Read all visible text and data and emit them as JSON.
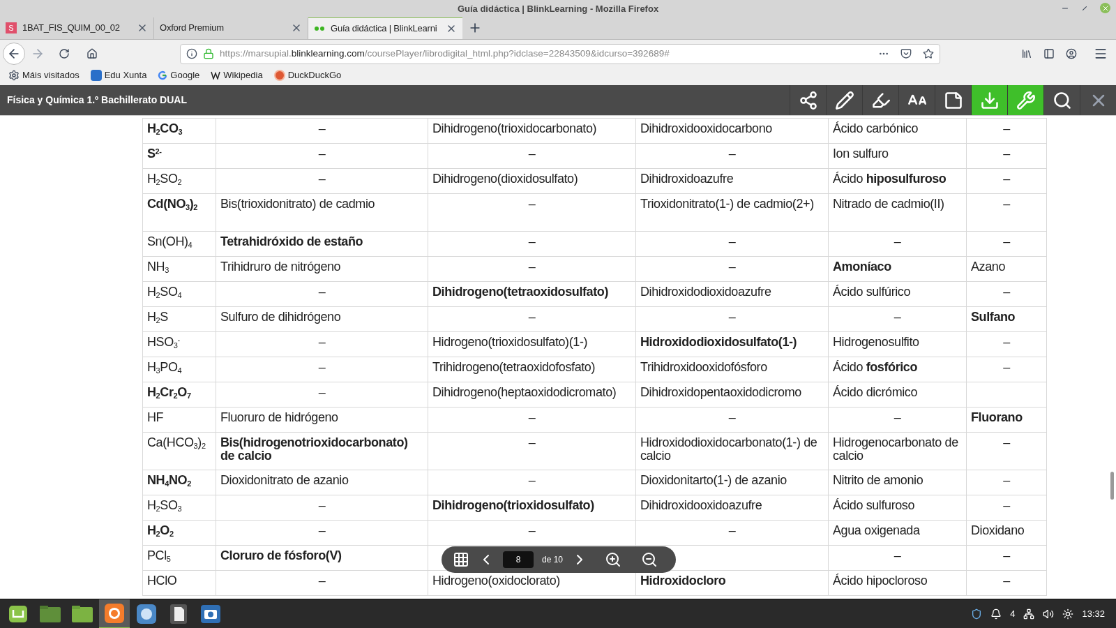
{
  "window": {
    "title": "Guía didáctica | BlinkLearning - Mozilla Firefox"
  },
  "tabs": [
    {
      "label": "1BAT_FIS_QUIM_00_02",
      "favicon_text": "S",
      "selected": false
    },
    {
      "label": "Oxford Premium",
      "selected": false
    },
    {
      "label": "Guía didáctica | BlinkLearni",
      "selected": true
    }
  ],
  "address": {
    "prefix": "https://marsupial.",
    "domain": "blinklearning.com",
    "path": "/coursePlayer/librodigital_html.php?idclase=22843509&idcurso=392689#"
  },
  "bookmarks": [
    {
      "label": "Máis visitados",
      "kind": "gear"
    },
    {
      "label": "Edu Xunta",
      "kind": "xunta"
    },
    {
      "label": "Google",
      "kind": "google"
    },
    {
      "label": "Wikipedia",
      "kind": "wikipedia"
    },
    {
      "label": "DuckDuckGo",
      "kind": "duck"
    }
  ],
  "app_bar": {
    "title": "Física y Química 1.º Bachillerato DUAL",
    "tools": [
      {
        "kind": "share",
        "active": false
      },
      {
        "kind": "pencil",
        "active": false
      },
      {
        "kind": "marker",
        "active": false
      },
      {
        "kind": "font-size",
        "active": false
      },
      {
        "kind": "note",
        "active": false
      },
      {
        "kind": "download",
        "active": true
      },
      {
        "kind": "wrench",
        "active": true
      },
      {
        "kind": "search",
        "active": false
      },
      {
        "kind": "close",
        "active": false
      }
    ]
  },
  "table": {
    "rows": [
      {
        "formula": "H$_{2}$CO$_{3}$",
        "bold": true,
        "cells": [
          {
            "kind": "dash",
            "t": "–"
          },
          {
            "kind": "text",
            "t": "Dihidrogeno(trioxidocarbonato)",
            "bold": false
          },
          {
            "kind": "text",
            "t": "Dihidroxidooxidocarbono",
            "bold": false
          },
          {
            "kind": "text",
            "t": "Ácido carbónico",
            "bold": false
          },
          {
            "kind": "dash",
            "t": "–"
          }
        ]
      },
      {
        "formula": "S$^{2-}$",
        "bold": true,
        "cells": [
          {
            "kind": "dash",
            "t": "–"
          },
          {
            "kind": "dash",
            "t": "–"
          },
          {
            "kind": "dash",
            "t": "–"
          },
          {
            "kind": "text",
            "t": "Ion sulfuro",
            "bold": false
          },
          {
            "kind": "dash",
            "t": "–"
          }
        ]
      },
      {
        "formula": "H$_{2}$SO$_{2}$",
        "bold": false,
        "cells": [
          {
            "kind": "dash",
            "t": "–"
          },
          {
            "kind": "text",
            "t": "Dihidrogeno(dioxidosulfato)",
            "bold": false
          },
          {
            "kind": "text",
            "t": "Dihidroxidoazufre",
            "bold": false
          },
          {
            "kind": "text",
            "t": "Ácido **hiposulfuroso**",
            "bold": false
          },
          {
            "kind": "dash",
            "t": "–"
          }
        ]
      },
      {
        "formula": "Cd(NO$_{3}$)$_{2}$",
        "bold": true,
        "tall": true,
        "cells": [
          {
            "kind": "text",
            "t": "Bis(trioxidonitrato) de cadmio",
            "bold": false
          },
          {
            "kind": "dash",
            "t": "–"
          },
          {
            "kind": "text",
            "t": "Trioxidonitrato(1-) de cadmio(2+)",
            "bold": false
          },
          {
            "kind": "text",
            "t": "Nitrado de cadmio(II)",
            "bold": false
          },
          {
            "kind": "dash",
            "t": "–"
          }
        ]
      },
      {
        "formula": "Sn(OH)$_{4}$",
        "bold": false,
        "cells": [
          {
            "kind": "text",
            "t": "Tetrahidróxido de estaño",
            "bold": true
          },
          {
            "kind": "dash",
            "t": "–"
          },
          {
            "kind": "dash",
            "t": "–"
          },
          {
            "kind": "dash",
            "t": "–"
          },
          {
            "kind": "dash",
            "t": "–"
          }
        ]
      },
      {
        "formula": "NH$_{3}$",
        "bold": false,
        "cells": [
          {
            "kind": "text",
            "t": "Trihidruro de nitrógeno",
            "bold": false
          },
          {
            "kind": "dash",
            "t": "–"
          },
          {
            "kind": "dash",
            "t": "–"
          },
          {
            "kind": "text",
            "t": "Amoníaco",
            "bold": true
          },
          {
            "kind": "text",
            "t": "Azano",
            "bold": false
          }
        ]
      },
      {
        "formula": "H$_{2}$SO$_{4}$",
        "bold": false,
        "cells": [
          {
            "kind": "dash",
            "t": "–"
          },
          {
            "kind": "text",
            "t": "Dihidrogeno(tetraoxidosulfato)",
            "bold": true
          },
          {
            "kind": "text",
            "t": "Dihidroxidodioxidoazufre",
            "bold": false
          },
          {
            "kind": "text",
            "t": "Ácido sulfúrico",
            "bold": false
          },
          {
            "kind": "dash",
            "t": "–"
          }
        ]
      },
      {
        "formula": "H$_{2}$S",
        "bold": false,
        "cells": [
          {
            "kind": "text",
            "t": "Sulfuro de dihidrógeno",
            "bold": false
          },
          {
            "kind": "dash",
            "t": "–"
          },
          {
            "kind": "dash",
            "t": "–"
          },
          {
            "kind": "dash",
            "t": "–"
          },
          {
            "kind": "text",
            "t": "Sulfano",
            "bold": true
          }
        ]
      },
      {
        "formula": "HSO$_{3}$$^{-}$",
        "bold": false,
        "cells": [
          {
            "kind": "dash",
            "t": "–"
          },
          {
            "kind": "text",
            "t": "Hidrogeno(trioxidosulfato)(1-)",
            "bold": false
          },
          {
            "kind": "text",
            "t": "Hidroxidodioxidosulfato(1-)",
            "bold": true
          },
          {
            "kind": "text",
            "t": "Hidrogenosulfito",
            "bold": false
          },
          {
            "kind": "dash",
            "t": "–"
          }
        ]
      },
      {
        "formula": "H$_{3}$PO$_{4}$",
        "bold": false,
        "cells": [
          {
            "kind": "dash",
            "t": "–"
          },
          {
            "kind": "text",
            "t": "Trihidrogeno(tetraoxidofosfato)",
            "bold": false
          },
          {
            "kind": "text",
            "t": "Trihidroxidooxidofósforo",
            "bold": false
          },
          {
            "kind": "text",
            "t": "Ácido **fosfórico**",
            "bold": false
          },
          {
            "kind": "dash",
            "t": "–"
          }
        ]
      },
      {
        "formula": "H$_{2}$Cr$_{2}$O$_{7}$",
        "bold": true,
        "cells": [
          {
            "kind": "dash",
            "t": "–"
          },
          {
            "kind": "text",
            "t": "Dihidrogeno(heptaoxidodicromato)",
            "bold": false
          },
          {
            "kind": "text",
            "t": "Dihidroxidopentaoxidodicromo",
            "bold": false
          },
          {
            "kind": "text",
            "t": "Ácido dicrómico",
            "bold": false
          },
          {
            "kind": "blank"
          }
        ]
      },
      {
        "formula": "HF",
        "bold": false,
        "cells": [
          {
            "kind": "text",
            "t": "Fluoruro de hidrógeno",
            "bold": false
          },
          {
            "kind": "dash",
            "t": "–"
          },
          {
            "kind": "dash",
            "t": "–"
          },
          {
            "kind": "dash",
            "t": "–"
          },
          {
            "kind": "text",
            "t": "Fluorano",
            "bold": true
          }
        ]
      },
      {
        "formula": "Ca(HCO$_{3}$)$_{2}$",
        "bold": false,
        "tall": true,
        "cells": [
          {
            "kind": "text",
            "t": "Bis(hidrogenotrioxidocarbonato) de calcio",
            "bold": true
          },
          {
            "kind": "dash",
            "t": "–"
          },
          {
            "kind": "text",
            "t": "Hidroxidodioxidocarbonato(1-) de calcio",
            "bold": false
          },
          {
            "kind": "text",
            "t": "Hidrogenocarbonato de calcio",
            "bold": false
          },
          {
            "kind": "dash",
            "t": "–"
          }
        ]
      },
      {
        "formula": "NH$_{4}$NO$_{2}$",
        "bold": true,
        "cells": [
          {
            "kind": "text",
            "t": "Dioxidonitrato de azanio",
            "bold": false
          },
          {
            "kind": "dash",
            "t": "–"
          },
          {
            "kind": "text",
            "t": "Dioxidonitarto(1-) de azanio",
            "bold": false
          },
          {
            "kind": "text",
            "t": "Nitrito de amonio",
            "bold": false
          },
          {
            "kind": "dash",
            "t": "–"
          }
        ]
      },
      {
        "formula": "H$_{2}$SO$_{3}$",
        "bold": false,
        "cells": [
          {
            "kind": "dash",
            "t": "–"
          },
          {
            "kind": "text",
            "t": "Dihidrogeno(trioxidosulfato)",
            "bold": true
          },
          {
            "kind": "text",
            "t": "Dihidroxidooxidoazufre",
            "bold": false
          },
          {
            "kind": "text",
            "t": "Ácido sulfuroso",
            "bold": false
          },
          {
            "kind": "dash",
            "t": "–"
          }
        ]
      },
      {
        "formula": "H$_{2}$O$_{2}$",
        "bold": true,
        "cells": [
          {
            "kind": "dash",
            "t": "–"
          },
          {
            "kind": "dash",
            "t": "–"
          },
          {
            "kind": "dash",
            "t": "–"
          },
          {
            "kind": "text",
            "t": "Agua oxigenada",
            "bold": false
          },
          {
            "kind": "text",
            "t": "Dioxidano",
            "bold": false
          }
        ]
      },
      {
        "formula": "PCl$_{5}$",
        "bold": false,
        "cells": [
          {
            "kind": "text",
            "t": "Cloruro de fósforo(V)",
            "bold": true
          },
          {
            "kind": "blank"
          },
          {
            "kind": "blank"
          },
          {
            "kind": "dash",
            "t": "–"
          },
          {
            "kind": "dash",
            "t": "–"
          }
        ]
      },
      {
        "formula": "HClO",
        "bold": false,
        "cells": [
          {
            "kind": "dash",
            "t": "–"
          },
          {
            "kind": "text",
            "t": "Hidrogeno(oxidoclorato)",
            "bold": false
          },
          {
            "kind": "text",
            "t": "Hidroxidocloro",
            "bold": true
          },
          {
            "kind": "text",
            "t": "Ácido hipocloroso",
            "bold": false
          },
          {
            "kind": "dash",
            "t": "–"
          }
        ]
      }
    ]
  },
  "pager": {
    "page": "8",
    "of": "de 10"
  },
  "taskbar": {
    "apps": [
      {
        "kind": "mint",
        "selected": false
      },
      {
        "kind": "folder-dark",
        "selected": false
      },
      {
        "kind": "folder",
        "selected": false
      },
      {
        "kind": "firefox",
        "selected": true
      },
      {
        "kind": "browser",
        "selected": false
      },
      {
        "kind": "file",
        "selected": false
      },
      {
        "kind": "camera",
        "selected": false
      }
    ],
    "notifications": "4",
    "time": "13:32"
  }
}
